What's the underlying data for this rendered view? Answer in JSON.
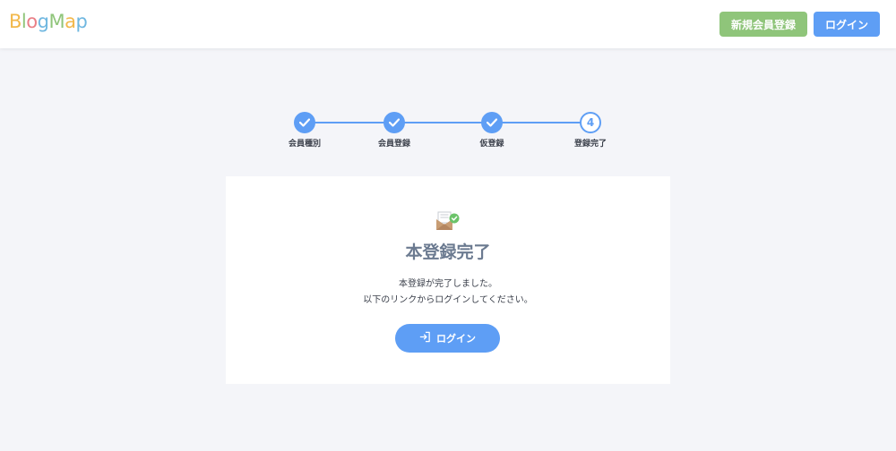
{
  "header": {
    "logo": {
      "letters": [
        "B",
        "l",
        "o",
        "g",
        "M",
        "a",
        "p"
      ],
      "colors": [
        "#f2b84b",
        "#8fc57a",
        "#e97f86",
        "#6fb7e0",
        "#8fc57a",
        "#f2b84b",
        "#6fb7e0"
      ]
    },
    "signup_label": "新規会員登録",
    "login_label": "ログイン"
  },
  "stepper": {
    "steps": [
      {
        "label": "会員種別",
        "status": "done"
      },
      {
        "label": "会員登録",
        "status": "done"
      },
      {
        "label": "仮登録",
        "status": "done"
      },
      {
        "label": "登録完了",
        "status": "current",
        "number": "4"
      }
    ]
  },
  "card": {
    "icon": "mail-check-icon",
    "title": "本登録完了",
    "message_line1": "本登録が完了しました。",
    "message_line2": "以下のリンクからログインしてください。",
    "login_button_label": "ログイン",
    "login_button_icon": "login-icon"
  },
  "colors": {
    "accent": "#5e9ef5",
    "signup": "#8fc57a",
    "background": "#f4f5f9",
    "title": "#6b7a90"
  }
}
